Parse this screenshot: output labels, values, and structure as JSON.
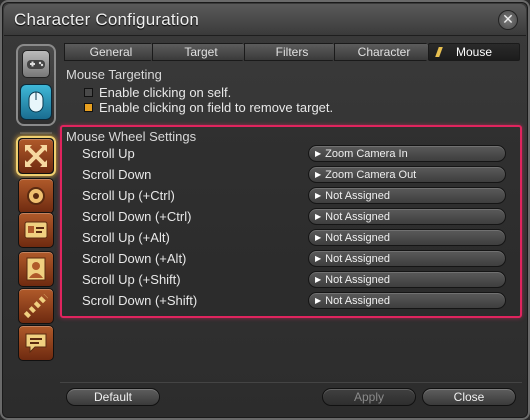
{
  "window": {
    "title": "Character Configuration"
  },
  "tabs": [
    {
      "label": "General",
      "active": false
    },
    {
      "label": "Target",
      "active": false
    },
    {
      "label": "Filters",
      "active": false
    },
    {
      "label": "Character",
      "active": false
    },
    {
      "label": "Mouse",
      "active": true
    }
  ],
  "mouse_targeting": {
    "heading": "Mouse Targeting",
    "options": [
      {
        "label": "Enable clicking on self.",
        "checked": false
      },
      {
        "label": "Enable clicking on field to remove target.",
        "checked": true
      }
    ]
  },
  "mouse_wheel": {
    "heading": "Mouse Wheel Settings",
    "rows": [
      {
        "label": "Scroll Up",
        "value": "Zoom Camera In"
      },
      {
        "label": "Scroll Down",
        "value": "Zoom Camera Out"
      },
      {
        "label": "Scroll Up (+Ctrl)",
        "value": "Not Assigned"
      },
      {
        "label": "Scroll Down (+Ctrl)",
        "value": "Not Assigned"
      },
      {
        "label": "Scroll Up (+Alt)",
        "value": "Not Assigned"
      },
      {
        "label": "Scroll Down (+Alt)",
        "value": "Not Assigned"
      },
      {
        "label": "Scroll Up (+Shift)",
        "value": "Not Assigned"
      },
      {
        "label": "Scroll Down (+Shift)",
        "value": "Not Assigned"
      }
    ]
  },
  "buttons": {
    "default": "Default",
    "apply": "Apply",
    "close": "Close"
  },
  "colors": {
    "highlight_border": "#e0245e",
    "checked": "#e8a020",
    "selected_icon_glow": "#f0d070"
  },
  "sidebar_icons": [
    "gamepad-icon",
    "mouse-icon",
    "crossed-arrows-icon",
    "gear-icon",
    "id-card-icon",
    "profile-icon",
    "checker-icon",
    "chat-icon"
  ]
}
